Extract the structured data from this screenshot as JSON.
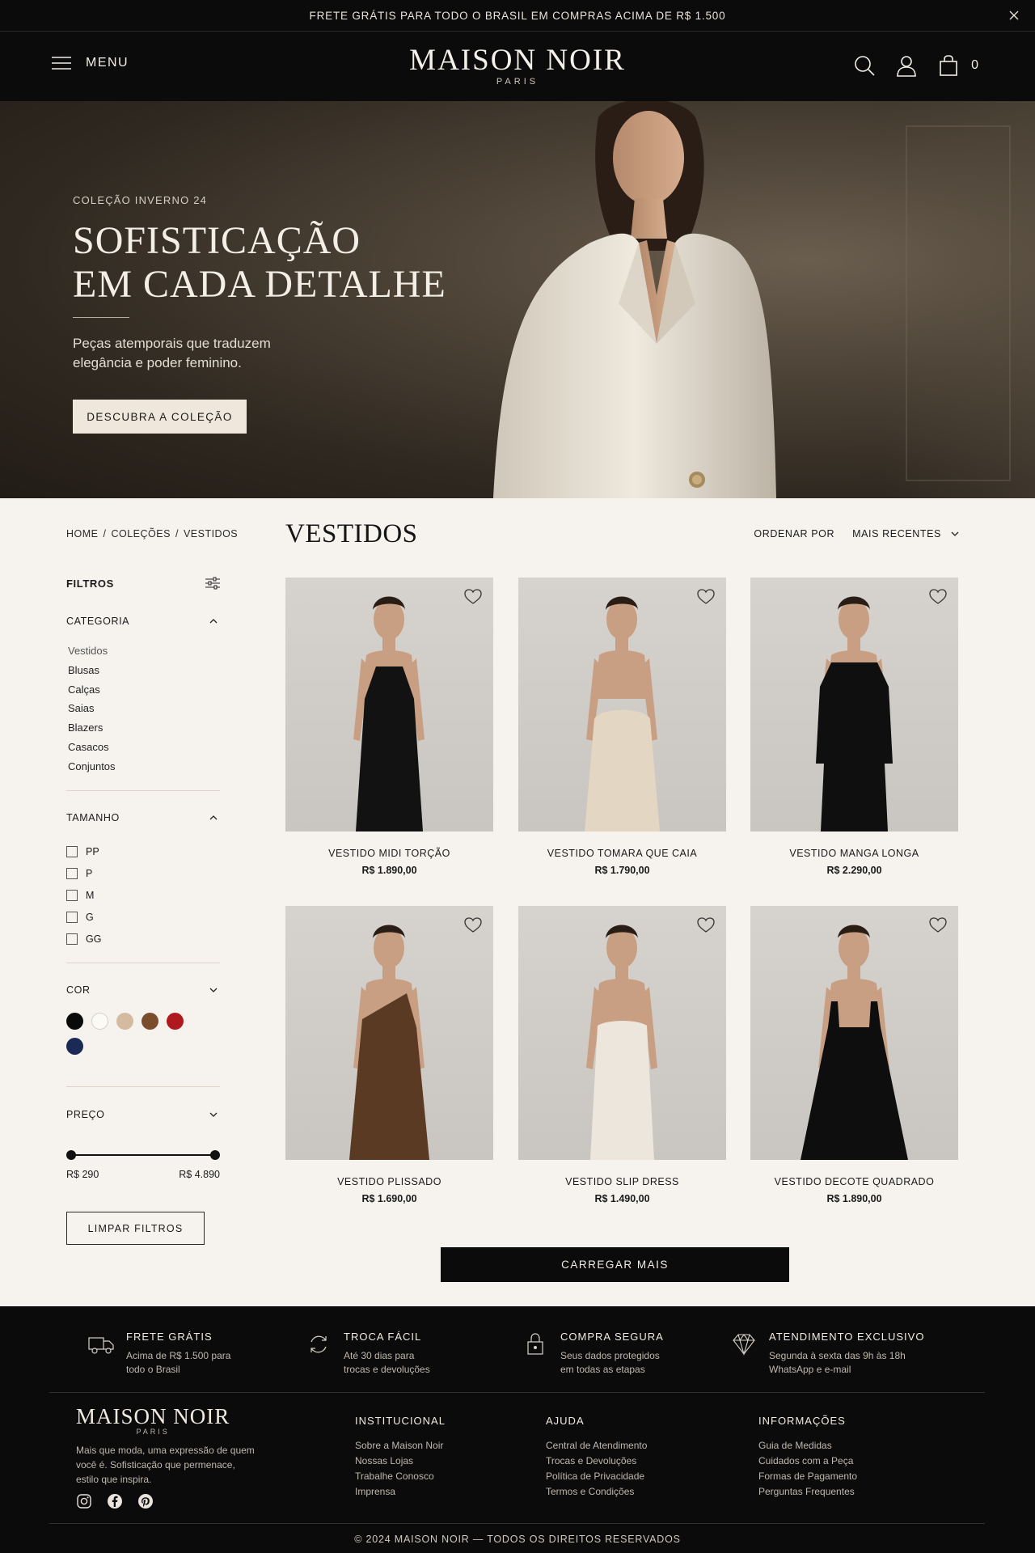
{
  "announcement": {
    "text": "FRETE GRÁTIS PARA TODO O BRASIL EM COMPRAS ACIMA DE R$ 1.500",
    "close_icon": "close-icon"
  },
  "header": {
    "menu_label": "MENU",
    "logo_name": "MAISON NOIR",
    "logo_city": "PARIS",
    "cart_count": "0",
    "icons": [
      "menu-icon",
      "search-icon",
      "user-icon",
      "bag-icon"
    ]
  },
  "hero": {
    "eyebrow": "COLEÇÃO INVERNO 24",
    "title_line1": "SOFISTICAÇÃO",
    "title_line2": "EM CADA DETALHE",
    "subtitle_line1": "Peças atemporais que traduzem",
    "subtitle_line2": "elegância e poder feminino.",
    "cta": "DESCUBRA A COLEÇÃO"
  },
  "breadcrumb": {
    "items": [
      "HOME",
      "COLEÇÕES",
      "VESTIDOS"
    ],
    "separator": "/"
  },
  "listing": {
    "title": "VESTIDOS",
    "sort_label": "ORDENAR POR",
    "sort_value": "MAIS RECENTES"
  },
  "filters": {
    "title": "FILTROS",
    "category": {
      "title": "CATEGORIA",
      "items": [
        "Vestidos",
        "Blusas",
        "Calças",
        "Saias",
        "Blazers",
        "Casacos",
        "Conjuntos"
      ],
      "selected": "Vestidos"
    },
    "size": {
      "title": "TAMANHO",
      "items": [
        "PP",
        "P",
        "M",
        "G",
        "GG"
      ]
    },
    "color": {
      "title": "COR",
      "swatches": [
        "#0a0a0a",
        "#fbfaf7",
        "#d4bba0",
        "#7a4e2d",
        "#b0181f",
        "#1b2a55"
      ]
    },
    "price": {
      "title": "PREÇO",
      "min_label": "R$ 290",
      "max_label": "R$ 4.890",
      "range_start_fraction": 0,
      "range_end_fraction": 1
    },
    "clear": "LIMPAR FILTROS"
  },
  "products": [
    {
      "name": "VESTIDO MIDI TORÇÃO",
      "price": "R$ 1.890,00",
      "dress_color": "#121212"
    },
    {
      "name": "VESTIDO TOMARA QUE CAIA",
      "price": "R$ 1.790,00",
      "dress_color": "#e3d6c3"
    },
    {
      "name": "VESTIDO MANGA LONGA",
      "price": "R$ 2.290,00",
      "dress_color": "#0f0f0f"
    },
    {
      "name": "VESTIDO PLISSADO",
      "price": "R$ 1.690,00",
      "dress_color": "#5a3a22"
    },
    {
      "name": "VESTIDO SLIP DRESS",
      "price": "R$ 1.490,00",
      "dress_color": "#ece6dc"
    },
    {
      "name": "VESTIDO DECOTE QUADRADO",
      "price": "R$ 1.890,00",
      "dress_color": "#0e0e0e"
    }
  ],
  "load_more": "CARREGAR MAIS",
  "features": [
    {
      "icon": "truck-icon",
      "title": "FRETE GRÁTIS",
      "line1": "Acima de R$ 1.500 para",
      "line2": "todo o Brasil"
    },
    {
      "icon": "exchange-icon",
      "title": "TROCA FÁCIL",
      "line1": "Até 30 dias para",
      "line2": "trocas e devoluções"
    },
    {
      "icon": "lock-icon",
      "title": "COMPRA SEGURA",
      "line1": "Seus dados protegidos",
      "line2": "em todas as etapas"
    },
    {
      "icon": "diamond-icon",
      "title": "ATENDIMENTO EXCLUSIVO",
      "line1": "Segunda à sexta das 9h às 18h",
      "line2": "WhatsApp e e-mail"
    }
  ],
  "footer": {
    "logo_name": "MAISON NOIR",
    "logo_city": "PARIS",
    "about_line1": "Mais que moda, uma expressão de quem",
    "about_line2": "você é. Sofisticação que permenace,",
    "about_line3": "estilo que inspira.",
    "social": [
      "instagram-icon",
      "facebook-icon",
      "pinterest-icon"
    ],
    "columns": [
      {
        "title": "INSTITUCIONAL",
        "links": [
          "Sobre a Maison Noir",
          "Nossas Lojas",
          "Trabalhe Conosco",
          "Imprensa"
        ]
      },
      {
        "title": "AJUDA",
        "links": [
          "Central de Atendimento",
          "Trocas e Devoluções",
          "Política de Privacidade",
          "Termos e Condições"
        ]
      },
      {
        "title": "INFORMAÇÕES",
        "links": [
          "Guia de Medidas",
          "Cuidados com a Peça",
          "Formas de Pagamento",
          "Perguntas Frequentes"
        ]
      }
    ],
    "copyright": "© 2024 MAISON NOIR — TODOS OS DIREITOS RESERVADOS"
  }
}
